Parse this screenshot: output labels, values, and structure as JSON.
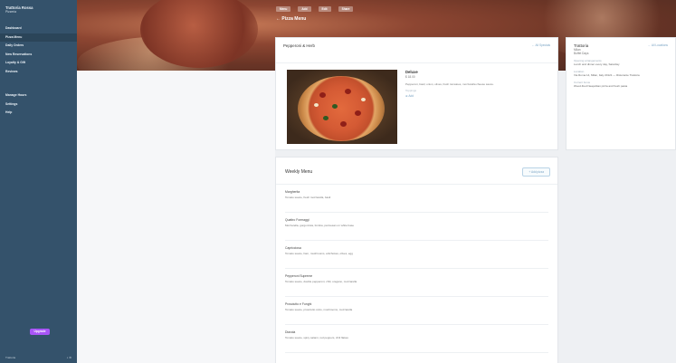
{
  "sidebar": {
    "brand_title": "Trattoria Rossa",
    "brand_sub": "Pizzeria",
    "items": [
      {
        "label": "Dashboard",
        "active": false
      },
      {
        "label": "Pizza Menu",
        "active": true
      },
      {
        "label": "Daily Orders",
        "active": false
      },
      {
        "label": "New Reservations",
        "active": false
      },
      {
        "label": "Loyalty & Gift",
        "active": false
      },
      {
        "label": "Reviews",
        "active": false
      }
    ],
    "items_secondary": [
      {
        "label": "Manage Hours"
      },
      {
        "label": "Settings"
      },
      {
        "label": "Help"
      }
    ],
    "new_button": "Upgrade",
    "footer_left": "Trattoria",
    "footer_right": "◐ ⚙"
  },
  "hero": {
    "tabs": [
      "Menu",
      "Add",
      "Edit",
      "Share"
    ],
    "page_title": "← Pizza Menu"
  },
  "pizza_card": {
    "title": "Pepperoni & Herb",
    "link": "← All Specials",
    "name": "Deluxe",
    "price": "$ 18.00",
    "description": "Pepperoni, basil, onion, olives, fresh tomatoes, mozzarella cheese sauce.",
    "label": "Toppings",
    "value": "⊕ Add"
  },
  "loyalty_card": {
    "title": "Trattoria",
    "link": "← All Locations",
    "sub1": "Milan",
    "sub2": "Buffet Days",
    "blocks": [
      {
        "label": "Opening arrangements",
        "text": "Lunch and dinner every day, Saturday"
      },
      {
        "label": "Location",
        "text": "Via Roma 14, Milan, Italy 20121 — Ristorante Trattoria"
      },
      {
        "label": "Current focus",
        "text": "Wood-fired Neapolitan pizza and fresh pasta"
      }
    ]
  },
  "weekly_menu": {
    "title": "Weekly Menu",
    "button": "+ Add pizza",
    "rows": [
      {
        "name": "Margherita",
        "desc": "Tomato sauce, fresh mozzarella, basil"
      },
      {
        "name": "Quattro Formaggi",
        "desc": "Mozzarella, gorgonzola, fontina, parmesan on white base"
      },
      {
        "name": "Capricciosa",
        "desc": "Tomato sauce, ham, mushrooms, artichokes, olives, egg"
      },
      {
        "name": "Pepperoni Supreme",
        "desc": "Tomato sauce, double pepperoni, chili, oregano, mozzarella"
      },
      {
        "name": "Prosciutto e Funghi",
        "desc": "Tomato sauce, prosciutto cotto, mushrooms, mozzarella"
      },
      {
        "name": "Diavola",
        "desc": "Tomato sauce, spicy salami, red peppers, chili flakes"
      }
    ]
  },
  "colors": {
    "sidebar": "#34526b",
    "accent": "#a855f7",
    "link": "#7aa4c4"
  }
}
